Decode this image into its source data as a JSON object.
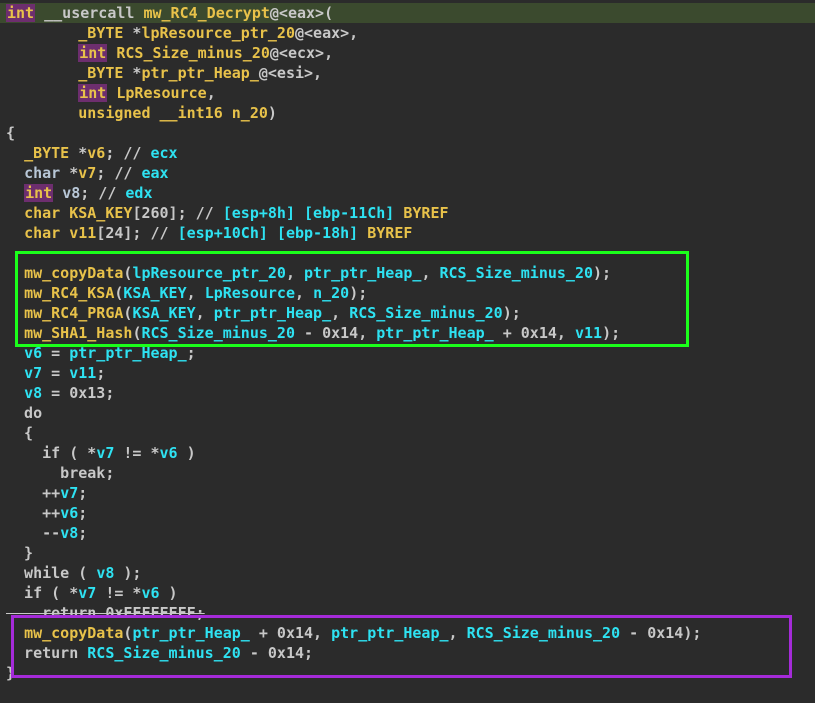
{
  "lines": [
    {
      "segments": [
        {
          "c": "kwbox",
          "t": "int"
        },
        {
          "c": "txt",
          "t": " __usercall "
        },
        {
          "c": "fn",
          "t": "mw_RC4_Decrypt"
        },
        {
          "c": "txt",
          "t": "@<eax>("
        }
      ],
      "hl": true
    },
    {
      "segments": [
        {
          "c": "txt",
          "t": "        "
        },
        {
          "c": "type",
          "t": "_BYTE"
        },
        {
          "c": "txt",
          "t": " *"
        },
        {
          "c": "fn",
          "t": "lpResource_ptr_20"
        },
        {
          "c": "txt",
          "t": "@<eax>,"
        }
      ]
    },
    {
      "segments": [
        {
          "c": "txt",
          "t": "        "
        },
        {
          "c": "kwbox",
          "t": "int"
        },
        {
          "c": "txt",
          "t": " "
        },
        {
          "c": "fn",
          "t": "RCS_Size_minus_20"
        },
        {
          "c": "txt",
          "t": "@<ecx>,"
        }
      ]
    },
    {
      "segments": [
        {
          "c": "txt",
          "t": "        "
        },
        {
          "c": "type",
          "t": "_BYTE"
        },
        {
          "c": "txt",
          "t": " *"
        },
        {
          "c": "fn",
          "t": "ptr_ptr_Heap_"
        },
        {
          "c": "txt",
          "t": "@<esi>,"
        }
      ]
    },
    {
      "segments": [
        {
          "c": "txt",
          "t": "        "
        },
        {
          "c": "kwbox",
          "t": "int"
        },
        {
          "c": "txt",
          "t": " "
        },
        {
          "c": "fn",
          "t": "LpResource"
        },
        {
          "c": "txt",
          "t": ","
        }
      ]
    },
    {
      "segments": [
        {
          "c": "txt",
          "t": "        "
        },
        {
          "c": "type",
          "t": "unsigned __int16"
        },
        {
          "c": "txt",
          "t": " "
        },
        {
          "c": "fn",
          "t": "n_20"
        },
        {
          "c": "txt",
          "t": ")"
        }
      ]
    },
    {
      "segments": [
        {
          "c": "txt",
          "t": "{"
        }
      ]
    },
    {
      "segments": [
        {
          "c": "txt",
          "t": "  "
        },
        {
          "c": "type",
          "t": "_BYTE"
        },
        {
          "c": "txt",
          "t": " *"
        },
        {
          "c": "fn",
          "t": "v6"
        },
        {
          "c": "txt",
          "t": "; // "
        },
        {
          "c": "cmt",
          "t": "ecx"
        }
      ]
    },
    {
      "segments": [
        {
          "c": "txt",
          "t": "  "
        },
        {
          "c": "kw",
          "t": "char"
        },
        {
          "c": "txt",
          "t": " *"
        },
        {
          "c": "fn",
          "t": "v7"
        },
        {
          "c": "txt",
          "t": "; // "
        },
        {
          "c": "cmt",
          "t": "eax"
        }
      ]
    },
    {
      "segments": [
        {
          "c": "txt",
          "t": "  "
        },
        {
          "c": "kwbox",
          "t": "int"
        },
        {
          "c": "txt",
          "t": " "
        },
        {
          "c": "kw",
          "t": "v8"
        },
        {
          "c": "txt",
          "t": "; // "
        },
        {
          "c": "cmt",
          "t": "edx"
        }
      ]
    },
    {
      "segments": [
        {
          "c": "txt",
          "t": "  "
        },
        {
          "c": "type",
          "t": "char"
        },
        {
          "c": "txt",
          "t": " "
        },
        {
          "c": "fn",
          "t": "KSA_KEY"
        },
        {
          "c": "txt",
          "t": "[260]; // "
        },
        {
          "c": "cmt",
          "t": "[esp+8h] [ebp-11Ch]"
        },
        {
          "c": "txt",
          "t": " "
        },
        {
          "c": "fn",
          "t": "BYREF"
        }
      ]
    },
    {
      "segments": [
        {
          "c": "txt",
          "t": "  "
        },
        {
          "c": "type",
          "t": "char"
        },
        {
          "c": "txt",
          "t": " "
        },
        {
          "c": "fn",
          "t": "v11"
        },
        {
          "c": "txt",
          "t": "[24]; // "
        },
        {
          "c": "cmt",
          "t": "[esp+10Ch] [ebp-18h]"
        },
        {
          "c": "txt",
          "t": " "
        },
        {
          "c": "fn",
          "t": "BYREF"
        }
      ]
    },
    {
      "segments": [
        {
          "c": "txt",
          "t": ""
        }
      ]
    },
    {
      "segments": [
        {
          "c": "txt",
          "t": "  "
        },
        {
          "c": "fn",
          "t": "mw_copyData"
        },
        {
          "c": "txt",
          "t": "("
        },
        {
          "c": "var",
          "t": "lpResource_ptr_20"
        },
        {
          "c": "txt",
          "t": ", "
        },
        {
          "c": "var",
          "t": "ptr_ptr_Heap_"
        },
        {
          "c": "txt",
          "t": ", "
        },
        {
          "c": "var",
          "t": "RCS_Size_minus_20"
        },
        {
          "c": "txt",
          "t": ");"
        }
      ]
    },
    {
      "segments": [
        {
          "c": "txt",
          "t": "  "
        },
        {
          "c": "fn",
          "t": "mw_RC4_KSA"
        },
        {
          "c": "txt",
          "t": "("
        },
        {
          "c": "var",
          "t": "KSA_KEY"
        },
        {
          "c": "txt",
          "t": ", "
        },
        {
          "c": "var",
          "t": "LpResource"
        },
        {
          "c": "txt",
          "t": ", "
        },
        {
          "c": "var",
          "t": "n_20"
        },
        {
          "c": "txt",
          "t": ");"
        }
      ]
    },
    {
      "segments": [
        {
          "c": "txt",
          "t": "  "
        },
        {
          "c": "fn",
          "t": "mw_RC4_PRGA"
        },
        {
          "c": "txt",
          "t": "("
        },
        {
          "c": "var",
          "t": "KSA_KEY"
        },
        {
          "c": "txt",
          "t": ", "
        },
        {
          "c": "var",
          "t": "ptr_ptr_Heap_"
        },
        {
          "c": "txt",
          "t": ", "
        },
        {
          "c": "var",
          "t": "RCS_Size_minus_20"
        },
        {
          "c": "txt",
          "t": ");"
        }
      ]
    },
    {
      "segments": [
        {
          "c": "txt",
          "t": "  "
        },
        {
          "c": "fn",
          "t": "mw_SHA1_Hash"
        },
        {
          "c": "txt",
          "t": "("
        },
        {
          "c": "var",
          "t": "RCS_Size_minus_20"
        },
        {
          "c": "txt",
          "t": " - 0x14, "
        },
        {
          "c": "var",
          "t": "ptr_ptr_Heap_"
        },
        {
          "c": "txt",
          "t": " + 0x14, "
        },
        {
          "c": "var",
          "t": "v11"
        },
        {
          "c": "txt",
          "t": ");"
        }
      ]
    },
    {
      "segments": [
        {
          "c": "txt",
          "t": "  "
        },
        {
          "c": "var",
          "t": "v6"
        },
        {
          "c": "txt",
          "t": " = "
        },
        {
          "c": "var",
          "t": "ptr_ptr_Heap_"
        },
        {
          "c": "txt",
          "t": ";"
        }
      ]
    },
    {
      "segments": [
        {
          "c": "txt",
          "t": "  "
        },
        {
          "c": "var",
          "t": "v7"
        },
        {
          "c": "txt",
          "t": " = "
        },
        {
          "c": "var",
          "t": "v11"
        },
        {
          "c": "txt",
          "t": ";"
        }
      ]
    },
    {
      "segments": [
        {
          "c": "txt",
          "t": "  "
        },
        {
          "c": "var",
          "t": "v8"
        },
        {
          "c": "txt",
          "t": " = 0x13;"
        }
      ]
    },
    {
      "segments": [
        {
          "c": "txt",
          "t": "  do"
        }
      ]
    },
    {
      "segments": [
        {
          "c": "txt",
          "t": "  {"
        }
      ]
    },
    {
      "segments": [
        {
          "c": "txt",
          "t": "    if ( *"
        },
        {
          "c": "var",
          "t": "v7"
        },
        {
          "c": "txt",
          "t": " != *"
        },
        {
          "c": "var",
          "t": "v6"
        },
        {
          "c": "txt",
          "t": " )"
        }
      ]
    },
    {
      "segments": [
        {
          "c": "txt",
          "t": "      break;"
        }
      ]
    },
    {
      "segments": [
        {
          "c": "txt",
          "t": "    ++"
        },
        {
          "c": "var",
          "t": "v7"
        },
        {
          "c": "txt",
          "t": ";"
        }
      ]
    },
    {
      "segments": [
        {
          "c": "txt",
          "t": "    ++"
        },
        {
          "c": "var",
          "t": "v6"
        },
        {
          "c": "txt",
          "t": ";"
        }
      ]
    },
    {
      "segments": [
        {
          "c": "txt",
          "t": "    --"
        },
        {
          "c": "var",
          "t": "v8"
        },
        {
          "c": "txt",
          "t": ";"
        }
      ]
    },
    {
      "segments": [
        {
          "c": "txt",
          "t": "  }"
        }
      ]
    },
    {
      "segments": [
        {
          "c": "txt",
          "t": "  while ( "
        },
        {
          "c": "var",
          "t": "v8"
        },
        {
          "c": "txt",
          "t": " );"
        }
      ]
    },
    {
      "segments": [
        {
          "c": "txt",
          "t": "  if ( *"
        },
        {
          "c": "var",
          "t": "v7"
        },
        {
          "c": "txt",
          "t": " != *"
        },
        {
          "c": "var",
          "t": "v6"
        },
        {
          "c": "txt",
          "t": " )"
        }
      ]
    },
    {
      "segments": [
        {
          "c": "txt strike",
          "t": "    return 0xFFFFFFFF;"
        }
      ]
    },
    {
      "segments": [
        {
          "c": "txt",
          "t": "  "
        },
        {
          "c": "fn",
          "t": "mw_copyData"
        },
        {
          "c": "txt",
          "t": "("
        },
        {
          "c": "var",
          "t": "ptr_ptr_Heap_"
        },
        {
          "c": "txt",
          "t": " + 0x14, "
        },
        {
          "c": "var",
          "t": "ptr_ptr_Heap_"
        },
        {
          "c": "txt",
          "t": ", "
        },
        {
          "c": "var",
          "t": "RCS_Size_minus_20"
        },
        {
          "c": "txt",
          "t": " - 0x14);"
        }
      ]
    },
    {
      "segments": [
        {
          "c": "txt",
          "t": "  return "
        },
        {
          "c": "var",
          "t": "RCS_Size_minus_20"
        },
        {
          "c": "txt",
          "t": " - 0x14;"
        }
      ]
    },
    {
      "segments": [
        {
          "c": "txt",
          "t": "}"
        }
      ]
    }
  ]
}
